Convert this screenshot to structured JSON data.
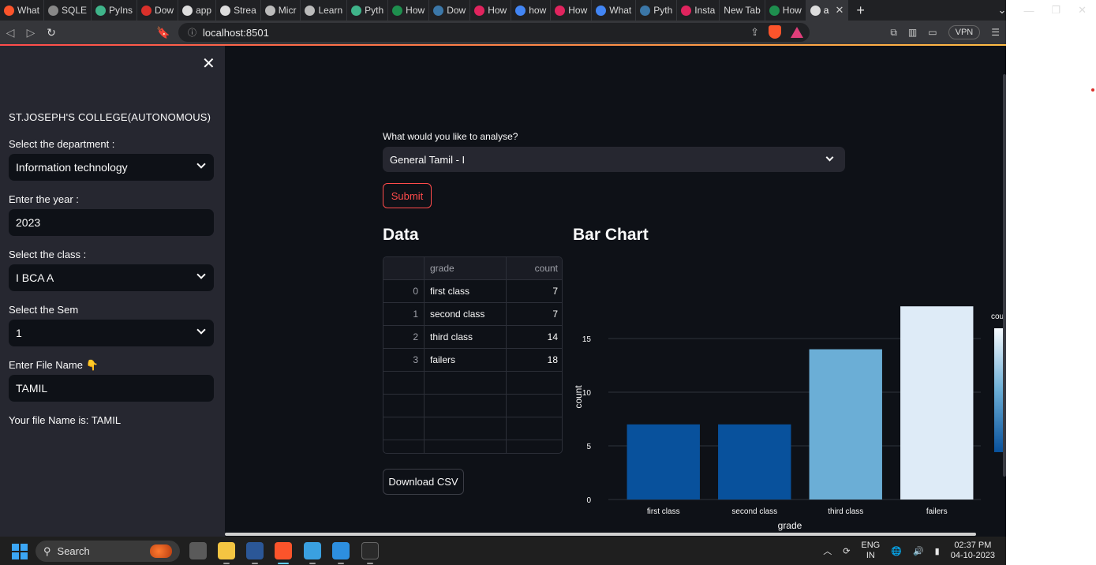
{
  "browser": {
    "tabs": [
      {
        "label": "What",
        "color": "#fb542b"
      },
      {
        "label": "SQLE",
        "color": "#888888"
      },
      {
        "label": "PyIns",
        "color": "#3fb48a"
      },
      {
        "label": "Dow",
        "color": "#d9302a"
      },
      {
        "label": "app",
        "color": "#dddddd"
      },
      {
        "label": "Strea",
        "color": "#dddddd"
      },
      {
        "label": "Micr",
        "color": "#bbbbbb"
      },
      {
        "label": "Learn",
        "color": "#bbbbbb"
      },
      {
        "label": "Pyth",
        "color": "#3fb48a"
      },
      {
        "label": "How",
        "color": "#1e8f4e"
      },
      {
        "label": "Dow",
        "color": "#3b77a8"
      },
      {
        "label": "How",
        "color": "#e0245e"
      },
      {
        "label": "how",
        "color": "#4285f4"
      },
      {
        "label": "How",
        "color": "#e0245e"
      },
      {
        "label": "What",
        "color": "#4285f4"
      },
      {
        "label": "Pyth",
        "color": "#3b77a8"
      },
      {
        "label": "Insta",
        "color": "#e0245e"
      },
      {
        "label": "New Tab",
        "color": ""
      },
      {
        "label": "How",
        "color": "#1e8f4e"
      },
      {
        "label": "a",
        "color": "#dddddd"
      }
    ],
    "url": "localhost:8501",
    "vpn_label": "VPN"
  },
  "sidebar": {
    "college": "ST.JOSEPH'S COLLEGE(AUTONOMOUS)",
    "department_label": "Select the department :",
    "department_value": "Information technology",
    "year_label": "Enter the year :",
    "year_value": "2023",
    "class_label": "Select the class :",
    "class_value": "I BCA A",
    "sem_label": "Select the Sem",
    "sem_value": "1",
    "filename_label": "Enter File Name 👇",
    "filename_value": "TAMIL",
    "filename_result": "Your file Name is: TAMIL"
  },
  "main": {
    "question_label": "What would you like to analyse?",
    "question_value": "General Tamil - I",
    "submit_label": "Submit",
    "data_heading": "Data",
    "chart_heading": "Bar Chart",
    "download_label": "Download CSV",
    "table": {
      "columns": [
        "",
        "grade",
        "count"
      ],
      "rows": [
        [
          "0",
          "first class",
          "7"
        ],
        [
          "1",
          "second class",
          "7"
        ],
        [
          "2",
          "third class",
          "14"
        ],
        [
          "3",
          "failers",
          "18"
        ]
      ]
    }
  },
  "chart_data": {
    "type": "bar",
    "categories": [
      "first class",
      "second class",
      "third class",
      "failers"
    ],
    "values": [
      7,
      7,
      14,
      18
    ],
    "xlabel": "grade",
    "ylabel": "count",
    "ylim": [
      0,
      18
    ],
    "yticks": [
      0,
      5,
      10,
      15
    ],
    "colorbar_title": "cou",
    "bar_colors": [
      "#08519c",
      "#08519c",
      "#6baed6",
      "#deebf7"
    ]
  },
  "taskbar": {
    "search_label": "Search",
    "lang_top": "ENG",
    "lang_bottom": "IN",
    "time": "02:37 PM",
    "date": "04-10-2023"
  }
}
